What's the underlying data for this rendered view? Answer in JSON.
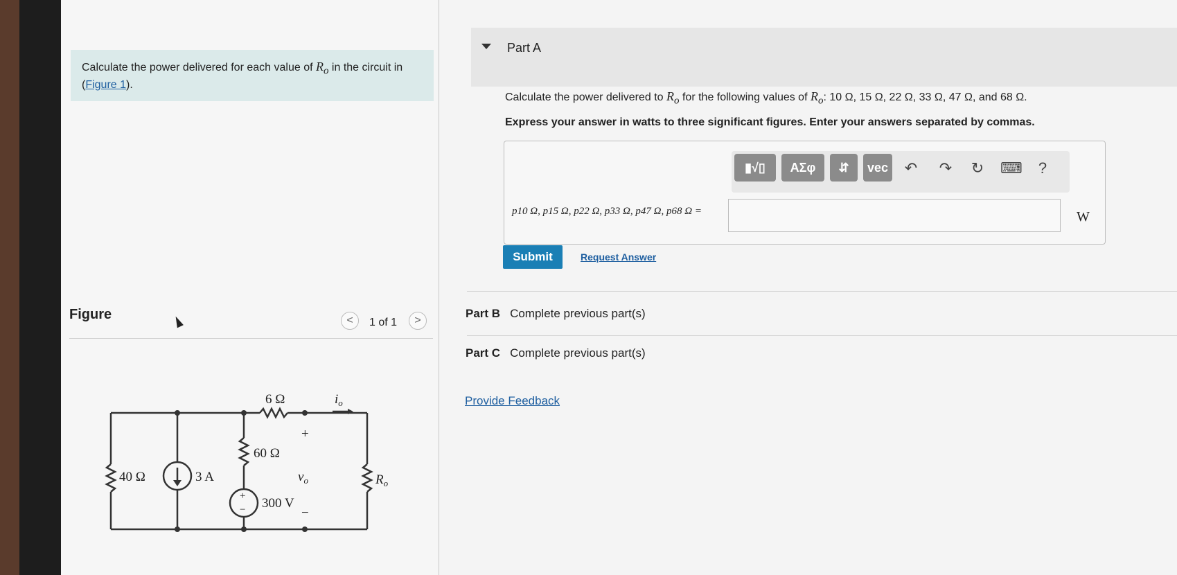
{
  "problem": {
    "text_before": "Calculate the power delivered for each value of ",
    "variable": "R",
    "variable_sub": "o",
    "text_after": " in the circuit in (",
    "figure_link": "Figure 1",
    "text_end": ")."
  },
  "figure": {
    "label": "Figure",
    "pager_text": "1 of 1",
    "prev_glyph": "<",
    "next_glyph": ">",
    "circuit": {
      "r6": "6 Ω",
      "io": "i",
      "io_sub": "o",
      "plus_top": "+",
      "r60": "60 Ω",
      "r40": "40 Ω",
      "i3": "3 A",
      "vo": "v",
      "vo_sub": "o",
      "ro": "R",
      "ro_sub": "o",
      "v300": "300 V",
      "minus_bottom": "−",
      "src_plus": "+",
      "src_minus": "−"
    }
  },
  "partA": {
    "title": "Part A",
    "question_prefix": "Calculate the power delivered to ",
    "question_var": "R",
    "question_var_sub": "o",
    "question_mid": " for the following values of ",
    "question_values": ": 10 Ω, 15 Ω, 22 Ω, 33 Ω, 47 Ω, and 68 Ω.",
    "instructions": "Express your answer in watts to three significant figures. Enter your answers separated by commas.",
    "answer_label": "p10 Ω, p15 Ω, p22 Ω, p33 Ω, p47 Ω, p68 Ω =",
    "answer_value": "",
    "unit": "W",
    "toolbar": {
      "templates": "▮√▯",
      "greek": "ΑΣφ",
      "arrows": "⇵",
      "vec": "vec",
      "undo": "↶",
      "redo": "↷",
      "reset": "↻",
      "keyboard": "⌨",
      "help": "?"
    },
    "submit_label": "Submit",
    "request_label": "Request Answer"
  },
  "partB": {
    "title": "Part B",
    "status": "Complete previous part(s)"
  },
  "partC": {
    "title": "Part C",
    "status": "Complete previous part(s)"
  },
  "feedback_label": "Provide Feedback"
}
